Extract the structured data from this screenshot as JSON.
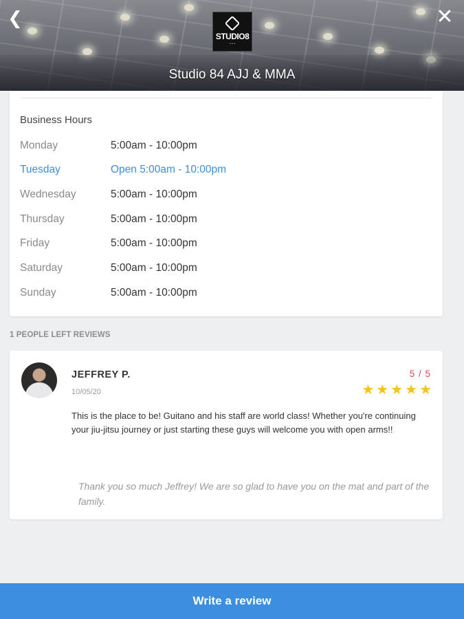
{
  "header": {
    "title": "Studio 84 AJJ & MMA",
    "logo_text": "STUDIO8",
    "back_icon": "chevron-left-icon",
    "close_icon": "close-icon"
  },
  "business_hours": {
    "title": "Business Hours",
    "rows": [
      {
        "day": "Monday",
        "time": "5:00am - 10:00pm"
      },
      {
        "day": "Tuesday",
        "time": "Open 5:00am - 10:00pm"
      },
      {
        "day": "Wednesday",
        "time": "5:00am - 10:00pm"
      },
      {
        "day": "Thursday",
        "time": "5:00am - 10:00pm"
      },
      {
        "day": "Friday",
        "time": "5:00am - 10:00pm"
      },
      {
        "day": "Saturday",
        "time": "5:00am - 10:00pm"
      },
      {
        "day": "Sunday",
        "time": "5:00am - 10:00pm"
      }
    ],
    "highlight_color": "#3b8fde"
  },
  "reviews": {
    "count_label": "1 PEOPLE LEFT REVIEWS",
    "items": [
      {
        "name": "JEFFREY P.",
        "date": "10/05/20",
        "rating_text": "5 / 5",
        "stars": 5,
        "text": "This is the place to be! Guitano and his staff are world class! Whether you're continuing your jiu-jitsu journey or just starting these guys will welcome you with open arms!!",
        "response": "Thank you so much Jeffrey! We are so glad to have you on the mat and part of the family."
      }
    ]
  },
  "footer": {
    "write_review_label": "Write a review",
    "button_color": "#3c8ee0"
  },
  "colors": {
    "star": "#f6c21c",
    "rating": "#d64a5a"
  }
}
